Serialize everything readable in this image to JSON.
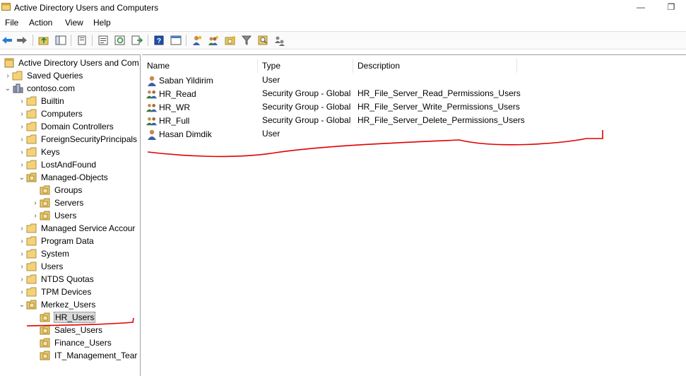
{
  "window": {
    "title": "Active Directory Users and Computers",
    "minimize": "—",
    "restore": "❐"
  },
  "menu": [
    "File",
    "Action",
    "View",
    "Help"
  ],
  "toolbar": [
    "back-icon",
    "forward-icon",
    "up-folder-icon",
    "show-hide-tree-icon",
    "delete-icon",
    "properties-icon",
    "refresh-icon",
    "export-list-icon",
    "help-icon",
    "view-icon",
    "new-user-icon",
    "new-group-icon",
    "new-ou-icon",
    "filter-icon",
    "find-icon",
    "delegate-icon"
  ],
  "tree": {
    "root": "Active Directory Users and Com",
    "items": [
      {
        "label": "Saved Queries",
        "level": 1,
        "chevron": "›"
      },
      {
        "label": "contoso.com",
        "level": 1,
        "chevron": "⌄"
      },
      {
        "label": "Builtin",
        "level": 2,
        "chevron": "›"
      },
      {
        "label": "Computers",
        "level": 2,
        "chevron": "›"
      },
      {
        "label": "Domain Controllers",
        "level": 2,
        "chevron": "›"
      },
      {
        "label": "ForeignSecurityPrincipals",
        "level": 2,
        "chevron": "›"
      },
      {
        "label": "Keys",
        "level": 2,
        "chevron": "›"
      },
      {
        "label": "LostAndFound",
        "level": 2,
        "chevron": "›"
      },
      {
        "label": "Managed-Objects",
        "level": 2,
        "chevron": "⌄"
      },
      {
        "label": "Groups",
        "level": 3,
        "chevron": ""
      },
      {
        "label": "Servers",
        "level": 3,
        "chevron": "›"
      },
      {
        "label": "Users",
        "level": 3,
        "chevron": "›"
      },
      {
        "label": "Managed Service Accour",
        "level": 2,
        "chevron": "›"
      },
      {
        "label": "Program Data",
        "level": 2,
        "chevron": "›"
      },
      {
        "label": "System",
        "level": 2,
        "chevron": "›"
      },
      {
        "label": "Users",
        "level": 2,
        "chevron": "›"
      },
      {
        "label": "NTDS Quotas",
        "level": 2,
        "chevron": "›"
      },
      {
        "label": "TPM Devices",
        "level": 2,
        "chevron": "›"
      },
      {
        "label": "Merkez_Users",
        "level": 2,
        "chevron": "⌄"
      },
      {
        "label": "HR_Users",
        "level": 3,
        "chevron": "",
        "selected": true
      },
      {
        "label": "Sales_Users",
        "level": 3,
        "chevron": ""
      },
      {
        "label": "Finance_Users",
        "level": 3,
        "chevron": ""
      },
      {
        "label": "IT_Management_Tear",
        "level": 3,
        "chevron": ""
      }
    ]
  },
  "list": {
    "columns": [
      "Name",
      "Type",
      "Description"
    ],
    "rows": [
      {
        "name": "Saban Yildirim",
        "type": "User",
        "description": "",
        "icon": "user-icon"
      },
      {
        "name": "HR_Read",
        "type": "Security Group - Global",
        "description": "HR_File_Server_Read_Permissions_Users",
        "icon": "group-icon"
      },
      {
        "name": "HR_WR",
        "type": "Security Group - Global",
        "description": "HR_File_Server_Write_Permissions_Users",
        "icon": "group-icon"
      },
      {
        "name": "HR_Full",
        "type": "Security Group - Global",
        "description": "HR_File_Server_Delete_Permissions_Users",
        "icon": "group-icon"
      },
      {
        "name": "Hasan Dimdik",
        "type": "User",
        "description": "",
        "icon": "user-icon"
      }
    ]
  },
  "colors": {
    "annotation": "#e00000",
    "folder": "#e8c86a",
    "selected": "#d9d9d9"
  }
}
